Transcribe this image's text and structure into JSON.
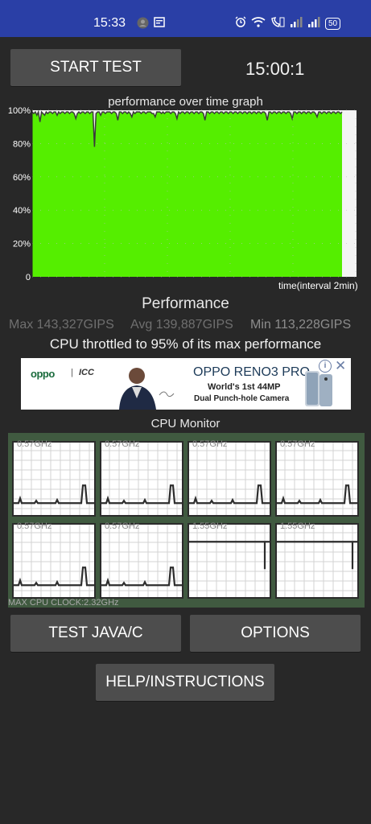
{
  "status_bar": {
    "time": "15:33",
    "battery": "50",
    "icons": [
      "avatar-icon",
      "screen-icon",
      "alarm-icon",
      "wifi-icon",
      "call-icon",
      "signal-icon",
      "signal-icon",
      "battery-icon"
    ]
  },
  "top": {
    "start_test_label": "START TEST",
    "timer": "15:00:1"
  },
  "graph": {
    "title": "performance over time graph",
    "x_label": "time(interval 2min)",
    "fill_color": "#55ee00"
  },
  "chart_data": {
    "type": "area",
    "title": "performance over time graph",
    "xlabel": "time(interval 2min)",
    "ylabel": "",
    "y_ticks": [
      "0",
      "20%",
      "40%",
      "60%",
      "80%",
      "100%"
    ],
    "ylim": [
      0,
      100
    ],
    "grid": true,
    "series": [
      {
        "values": [
          99,
          98,
          99,
          97,
          99,
          93,
          99,
          98,
          97,
          99,
          98,
          99,
          99,
          98,
          99,
          99,
          97,
          99,
          98,
          99,
          99,
          98,
          99,
          99,
          98,
          99,
          99,
          98,
          95,
          98,
          99,
          98,
          99,
          99,
          98,
          99,
          99,
          98,
          99,
          99,
          78,
          98,
          99,
          99,
          97,
          99,
          99,
          98,
          99,
          99,
          99,
          98,
          99,
          99,
          98,
          94,
          99,
          99,
          98,
          99,
          99,
          98,
          99,
          98,
          96,
          99,
          98,
          99,
          99,
          99,
          98,
          99,
          99,
          98,
          99,
          99,
          99,
          98,
          98,
          96,
          99,
          99,
          99,
          98,
          99,
          98,
          99,
          99,
          99,
          98,
          99,
          99,
          98,
          95,
          99,
          98,
          99,
          99,
          98,
          99,
          99,
          98,
          99,
          99,
          98,
          99,
          99,
          98,
          99,
          99,
          98,
          94,
          99,
          99,
          98,
          99,
          99,
          98,
          99,
          99,
          98,
          99,
          99,
          98,
          99,
          99,
          98,
          99,
          99,
          98,
          99,
          99,
          98,
          99,
          99,
          98,
          99,
          99,
          98,
          99,
          99,
          98,
          99,
          99,
          98,
          99,
          99,
          98,
          99,
          99,
          98,
          94,
          99,
          99,
          98,
          99,
          99,
          98,
          99,
          99,
          98,
          99,
          99,
          98,
          99,
          99,
          98,
          95,
          99,
          99,
          98,
          99,
          99,
          98,
          99,
          99,
          98,
          99,
          99,
          98,
          99,
          99,
          98,
          96,
          99,
          99,
          98,
          99,
          99,
          98,
          99,
          99,
          98,
          99,
          99,
          98,
          99,
          99,
          98,
          99
        ]
      }
    ]
  },
  "performance": {
    "title": "Performance",
    "max": "Max 143,327GIPS",
    "avg": "Avg 139,887GIPS",
    "min": "Min 113,228GIPS",
    "throttle_text": "CPU throttled to 95% of its max performance"
  },
  "ad": {
    "brand": "oppo",
    "partner": "ICC",
    "headline": "OPPO RENO3 PRO",
    "line1": "World's 1st 44MP",
    "line2": "Dual Punch-hole Camera",
    "info": "i",
    "close": "✕"
  },
  "cpu_monitor": {
    "title": "CPU Monitor",
    "cores": [
      {
        "freq": "0.57GHz",
        "level": 0.1
      },
      {
        "freq": "0.57GHz",
        "level": 0.1
      },
      {
        "freq": "0.57GHz",
        "level": 0.1
      },
      {
        "freq": "0.57GHz",
        "level": 0.1
      },
      {
        "freq": "0.57GHz",
        "level": 0.1
      },
      {
        "freq": "0.57GHz",
        "level": 0.1
      },
      {
        "freq": "1.55GHz",
        "level": 0.9
      },
      {
        "freq": "1.55GHz",
        "level": 0.9
      }
    ],
    "max_clock": "MAX CPU CLOCK:2.32GHz"
  },
  "buttons": {
    "test_java_label": "TEST JAVA/C",
    "options_label": "OPTIONS",
    "help_label": "HELP/INSTRUCTIONS"
  }
}
